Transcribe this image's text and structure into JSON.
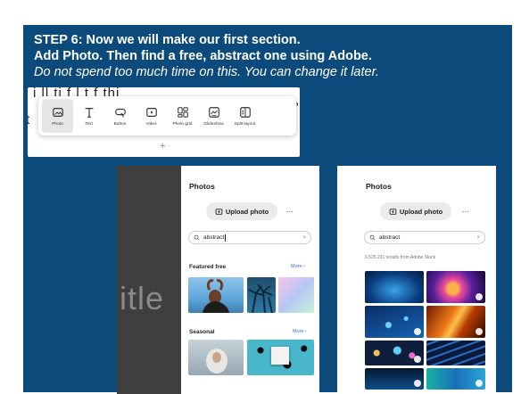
{
  "slide": {
    "line1": "STEP 6: Now we will make our first section.",
    "line2": "Add Photo. Then find a free, abstract one using Adobe.",
    "line3": "Do not spend too much time on this. You can change it later."
  },
  "toolbar": {
    "bg_text": "i           ll ti    f       l t f       thi",
    "bg_text_left": "t",
    "bg_text_right": ",",
    "items": [
      {
        "label": "Photo",
        "icon": "image-icon"
      },
      {
        "label": "Text",
        "icon": "text-icon"
      },
      {
        "label": "Button",
        "icon": "button-icon"
      },
      {
        "label": "Video",
        "icon": "video-icon"
      },
      {
        "label": "Photo grid",
        "icon": "photo-grid-icon"
      },
      {
        "label": "Glideshow",
        "icon": "glideshow-icon"
      },
      {
        "label": "Split layout",
        "icon": "split-layout-icon"
      }
    ],
    "plus": "+"
  },
  "panel1": {
    "canvas_text": "itle",
    "title": "Photos",
    "upload_label": "Upload photo",
    "more_dots": "...",
    "search_value": "abstract",
    "clear": "×",
    "featured_label": "Featured free",
    "featured_more": "More ›",
    "seasonal_label": "Seasonal",
    "seasonal_more": "More ›"
  },
  "panel2": {
    "title": "Photos",
    "upload_label": "Upload photo",
    "more_dots": "...",
    "search_value": "abstract",
    "clear": "×",
    "results": "6.525.231 results from Adobe Stock"
  },
  "colors": {
    "panel_bg": "#0d4a7c",
    "link": "#3b6fd0"
  }
}
